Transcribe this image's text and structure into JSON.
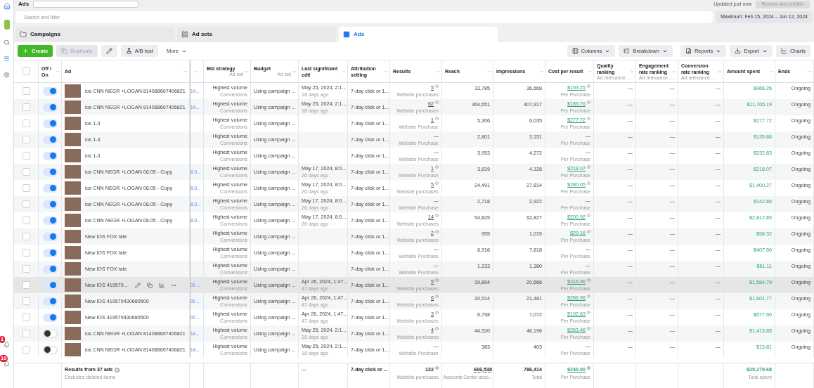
{
  "top_bar": {
    "title": "Ads",
    "status": "Updated just now",
    "publish_button": "Review and publish"
  },
  "search": {
    "placeholder": "Search and filter",
    "date_range": "Maximum: Feb 15, 2024 – Jun 12, 2024"
  },
  "tabs": [
    {
      "label": "Campaigns",
      "selected": false
    },
    {
      "label": "Ad sets",
      "selected": false
    },
    {
      "label": "Ads",
      "selected": true
    }
  ],
  "toolbar": {
    "left": [
      {
        "label": "Create",
        "kind": "primary"
      },
      {
        "label": "Duplicate",
        "kind": "disabled"
      },
      {
        "kind": "edit"
      },
      {
        "label": "A/B test",
        "kind": "test"
      },
      {
        "label": "More",
        "kind": "menu"
      }
    ],
    "right": [
      {
        "label": "Columns",
        "kind": "columns"
      },
      {
        "label": "Breakdown",
        "kind": "breakdown"
      },
      {
        "label": "Reports",
        "kind": "reports"
      },
      {
        "label": "Export",
        "kind": "export"
      },
      {
        "label": "Charts",
        "kind": "charts"
      }
    ]
  },
  "sidebar": {
    "badges": [
      "1",
      "19"
    ]
  },
  "table": {
    "select_all_checked": false,
    "columns": [
      {
        "label": "Off / On"
      },
      {
        "label": "Ad"
      },
      {
        "label": "Bid strategy",
        "sub": "Ad set"
      },
      {
        "label": "Budget",
        "sub": "Ad set"
      },
      {
        "label": "Last significant edit"
      },
      {
        "label": "Attribution setting"
      },
      {
        "label": "Results"
      },
      {
        "label": "Reach"
      },
      {
        "label": "Impressions"
      },
      {
        "label": "Cost per result"
      },
      {
        "label": "Quality ranking",
        "sub": "Ad relevance ..."
      },
      {
        "label": "Engagement rate ranking",
        "sub": "Ad relevance ..."
      },
      {
        "label": "Conversion rate ranking",
        "sub": "Ad relevance ..."
      },
      {
        "label": "Amount spent"
      },
      {
        "label": "Ends"
      }
    ],
    "rows": [
      {
        "on": true,
        "hovered": false,
        "name": "ios CNN NEGR +LOGAN 814088607406821",
        "link": "14...",
        "bid": "Highest volume",
        "bid_sub": "Conversions",
        "budget": "Using campaign ...",
        "edit": "May 25, 2024, 2:1...",
        "edit_ago": "18 days ago",
        "attribution": "7-day click or 1...",
        "results": "5",
        "results_label": "Website purchases",
        "note": true,
        "reach": "33,785",
        "impressions": "36,668",
        "cpr": "$193.25",
        "cpr_label": "Per Purchase",
        "rankings": [
          "—",
          "—",
          "—"
        ],
        "spent": "$966.26",
        "ends": "Ongoing"
      },
      {
        "on": true,
        "hovered": false,
        "name": "ios CNN NEGR +LOGAN 814088607406821",
        "link": "14...",
        "bid": "Highest volume",
        "bid_sub": "Conversions",
        "budget": "Using campaign ...",
        "edit": "May 25, 2024, 2:1...",
        "edit_ago": "18 days ago",
        "attribution": "7-day click or 1...",
        "results": "62",
        "results_label": "Website purchases",
        "note": true,
        "reach": "364,651",
        "impressions": "407,917",
        "cpr": "$189.76",
        "cpr_label": "Per Purchase",
        "rankings": [
          "—",
          "—",
          "—"
        ],
        "spent": "$11,765.19",
        "ends": "Ongoing"
      },
      {
        "on": true,
        "hovered": false,
        "name": "ios 1-3",
        "bid": "Highest volume",
        "bid_sub": "Conversions",
        "budget": "Using campaign ...",
        "attribution": "7-day click or 1...",
        "results": "1",
        "results_label": "Website Purchase",
        "note": true,
        "reach": "5,306",
        "impressions": "6,035",
        "cpr": "$277.72",
        "cpr_label": "Per Purchase",
        "rankings": [
          "—",
          "—",
          "—"
        ],
        "spent": "$277.72",
        "ends": "Ongoing"
      },
      {
        "on": true,
        "hovered": false,
        "name": "ios 1-3",
        "bid": "Highest volume",
        "bid_sub": "Conversions",
        "budget": "Using campaign ...",
        "attribution": "7-day click or 1...",
        "results": "—",
        "results_label": "Website Purchase",
        "note": false,
        "reach": "2,801",
        "impressions": "3,151",
        "cpr": "—",
        "cpr_label": "Per Purchase",
        "rankings": [
          "—",
          "—",
          "—"
        ],
        "spent": "$135.86",
        "ends": "Ongoing"
      },
      {
        "on": true,
        "hovered": false,
        "name": "ios 1-3",
        "bid": "Highest volume",
        "bid_sub": "Conversions",
        "budget": "Using campaign ...",
        "attribution": "7-day click or 1...",
        "results": "—",
        "results_label": "Website Purchase",
        "note": false,
        "reach": "3,953",
        "impressions": "4,272",
        "cpr": "—",
        "cpr_label": "Per Purchase",
        "rankings": [
          "—",
          "—",
          "—"
        ],
        "spent": "$232.83",
        "ends": "Ongoing"
      },
      {
        "on": true,
        "hovered": false,
        "name": "ios CNN NEGR +LOGAN 08.05 - Copy",
        "link": "8.0...",
        "bid": "Highest volume",
        "bid_sub": "Conversions",
        "budget": "Using campaign ...",
        "edit": "May 17, 2024, 8:0...",
        "edit_ago": "26 days ago",
        "attribution": "7-day click or 1...",
        "results": "1",
        "results_label": "Website Purchase",
        "note": true,
        "reach": "3,819",
        "impressions": "4,128",
        "cpr": "$218.07",
        "cpr_label": "Per Purchase",
        "rankings": [
          "—",
          "—",
          "—"
        ],
        "spent": "$218.07",
        "ends": "Ongoing"
      },
      {
        "on": true,
        "hovered": false,
        "name": "ios CNN NEGR +LOGAN 08.05 - Copy",
        "link": "8.0...",
        "bid": "Highest volume",
        "bid_sub": "Conversions",
        "budget": "Using campaign ...",
        "edit": "May 17, 2024, 8:0...",
        "edit_ago": "26 days ago",
        "attribution": "7-day click or 1...",
        "results": "5",
        "results_label": "Website purchases",
        "note": true,
        "reach": "24,491",
        "impressions": "27,814",
        "cpr": "$280.05",
        "cpr_label": "Per Purchase",
        "rankings": [
          "—",
          "—",
          "—"
        ],
        "spent": "$1,400.27",
        "ends": "Ongoing"
      },
      {
        "on": true,
        "hovered": false,
        "name": "ios CNN NEGR +LOGAN 08.05 - Copy",
        "link": "8.0...",
        "bid": "Highest volume",
        "bid_sub": "Conversions",
        "budget": "Using campaign ...",
        "edit": "May 17, 2024, 8:0...",
        "edit_ago": "26 days ago",
        "attribution": "7-day click or 1...",
        "results": "—",
        "results_label": "Website Purchase",
        "note": false,
        "reach": "2,718",
        "impressions": "2,922",
        "cpr": "—",
        "cpr_label": "Per Purchase",
        "rankings": [
          "—",
          "—",
          "—"
        ],
        "spent": "$142.86",
        "ends": "Ongoing"
      },
      {
        "on": true,
        "hovered": false,
        "name": "ios CNN NEGR +LOGAN 08.05 - Copy",
        "link": "8.0...",
        "bid": "Highest volume",
        "bid_sub": "Conversions",
        "budget": "Using campaign ...",
        "edit": "May 17, 2024, 8:0...",
        "edit_ago": "26 days ago",
        "attribution": "7-day click or 1...",
        "results": "14",
        "results_label": "Website purchases",
        "note": true,
        "reach": "54,825",
        "impressions": "62,827",
        "cpr": "$200.92",
        "cpr_label": "Per Purchase",
        "rankings": [
          "—",
          "—",
          "—"
        ],
        "spent": "$2,812.85",
        "ends": "Ongoing"
      },
      {
        "on": true,
        "hovered": false,
        "name": "New IOS FOX tate",
        "bid": "Highest volume",
        "bid_sub": "Conversions",
        "budget": "Using campaign ...",
        "attribution": "7-day click or 1...",
        "results": "2",
        "results_label": "Website purchases",
        "note": true,
        "reach": "955",
        "impressions": "1,015",
        "cpr": "$29.16",
        "cpr_label": "Per Purchase",
        "rankings": [
          "—",
          "—",
          "—"
        ],
        "spent": "$58.32",
        "ends": "Ongoing"
      },
      {
        "on": true,
        "hovered": false,
        "name": "New IOS FOX tate",
        "bid": "Highest volume",
        "bid_sub": "Conversions",
        "budget": "Using campaign ...",
        "attribution": "7-day click or 1...",
        "results": "—",
        "results_label": "Website Purchase",
        "note": false,
        "reach": "6,916",
        "impressions": "7,818",
        "cpr": "—",
        "cpr_label": "Per Purchase",
        "rankings": [
          "—",
          "—",
          "—"
        ],
        "spent": "$407.50",
        "ends": "Ongoing"
      },
      {
        "on": true,
        "hovered": false,
        "name": "New IOS FOX tate",
        "bid": "Highest volume",
        "bid_sub": "Conversions",
        "budget": "Using campaign ...",
        "attribution": "7-day click or 1...",
        "results": "—",
        "results_label": "Website Purchase",
        "note": false,
        "reach": "1,233",
        "impressions": "1,380",
        "cpr": "—",
        "cpr_label": "Per Purchase",
        "rankings": [
          "—",
          "—",
          "—"
        ],
        "spent": "$61.11",
        "ends": "Ongoing"
      },
      {
        "on": true,
        "hovered": true,
        "name": "New IOS 419579...",
        "link": "00 ...",
        "bid": "Highest volume",
        "bid_sub": "Conversions",
        "budget": "Using campaign ...",
        "edit": "Apr 26, 2024, 1:47...",
        "edit_ago": "47 days ago",
        "attribution": "7-day click or 1...",
        "results": "5",
        "results_label": "Website purchases",
        "note": true,
        "reach": "19,894",
        "impressions": "20,666",
        "cpr": "$316.96",
        "cpr_label": "Per Purchase",
        "rankings": [
          "—",
          "—",
          "—"
        ],
        "spent": "$1,584.79",
        "ends": "Ongoing"
      },
      {
        "on": true,
        "hovered": false,
        "name": "New IOS 419579430689500",
        "link": "00 ...",
        "bid": "Highest volume",
        "bid_sub": "Conversions",
        "budget": "Using campaign ...",
        "edit": "Apr 26, 2024, 1:47...",
        "edit_ago": "47 days ago",
        "attribution": "7-day click or 1...",
        "results": "6",
        "results_label": "Website purchases",
        "note": true,
        "reach": "20,514",
        "impressions": "21,481",
        "cpr": "$266.96",
        "cpr_label": "Per Purchase",
        "rankings": [
          "—",
          "—",
          "—"
        ],
        "spent": "$1,601.77",
        "ends": "Ongoing"
      },
      {
        "on": true,
        "hovered": false,
        "name": "New IOS 419579430689500",
        "link": "00 ...",
        "bid": "Highest volume",
        "bid_sub": "Conversions",
        "budget": "Using campaign ...",
        "edit": "Apr 26, 2024, 1:47...",
        "edit_ago": "47 days ago",
        "attribution": "7-day click or 1...",
        "results": "3",
        "results_label": "Website purchases",
        "note": true,
        "reach": "6,798",
        "impressions": "7,072",
        "cpr": "$192.63",
        "cpr_label": "Per Purchase",
        "rankings": [
          "—",
          "—",
          "—"
        ],
        "spent": "$577.90",
        "ends": "Ongoing"
      },
      {
        "on": false,
        "hovered": false,
        "name": "ios CNN NEGR +LOGAN 814088607406821",
        "link": "14...",
        "bid": "Highest volume",
        "bid_sub": "Conversions",
        "budget": "Using campaign ...",
        "edit": "May 25, 2024, 2:1...",
        "edit_ago": "18 days ago",
        "attribution": "7-day click or 1...",
        "results": "4",
        "results_label": "Website purchases",
        "note": true,
        "reach": "44,520",
        "impressions": "46,196",
        "cpr": "$353.46",
        "cpr_label": "Per Purchase",
        "rankings": [
          "—",
          "—",
          "—"
        ],
        "spent": "$1,413.85",
        "ends": "Ongoing"
      },
      {
        "on": false,
        "hovered": false,
        "name": "ios CNN NEGR +LOGAN 814088607406821",
        "link": "14...",
        "bid": "Highest volume",
        "bid_sub": "Conversions",
        "budget": "Using campaign ...",
        "edit": "May 25, 2024, 2:1...",
        "edit_ago": "18 days ago",
        "attribution": "7-day click or 1...",
        "results": "—",
        "results_label": "Website Purchase",
        "note": false,
        "reach": "383",
        "impressions": "403",
        "cpr": "—",
        "cpr_label": "Per Purchase",
        "rankings": [
          "—",
          "—",
          "—"
        ],
        "spent": "$13.81",
        "ends": "Ongoing"
      }
    ],
    "footer": {
      "title": "Results from 37 ads",
      "subtitle": "Excludes deleted items",
      "edit": "—",
      "attribution": "7-day click or ...",
      "results": "122",
      "results_label": "Website purchases",
      "reach": "666,538",
      "reach_label": "Accounts Center acco...",
      "impressions": "786,414",
      "impressions_label": "Total",
      "cpr": "$240.00",
      "cpr_label": "Per Purchase",
      "spent": "$29,279.68",
      "spent_label": "Total spent"
    }
  }
}
